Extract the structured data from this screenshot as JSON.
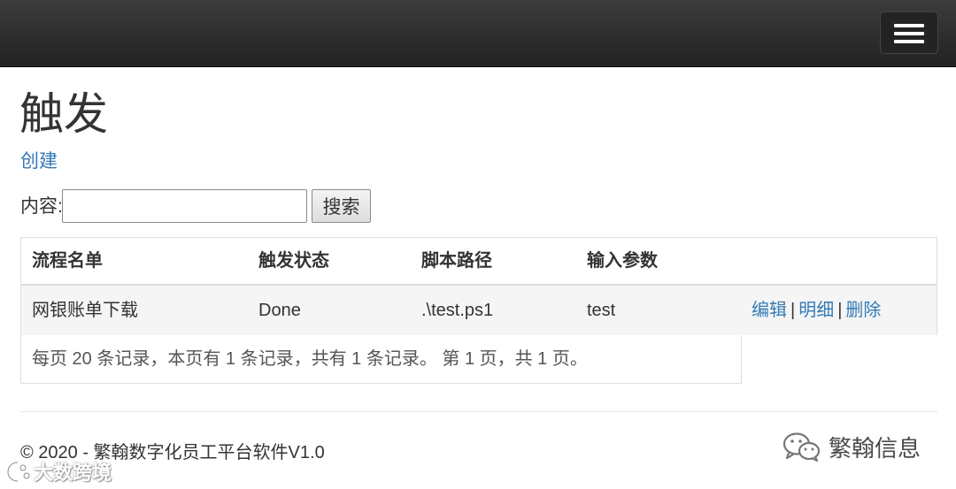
{
  "navbar": {
    "toggle_icon": "hamburger-menu-icon"
  },
  "page": {
    "title": "触发",
    "create_link": "创建"
  },
  "search": {
    "label": "内容:",
    "value": "",
    "placeholder": "",
    "button_label": "搜索"
  },
  "table": {
    "headers": [
      "流程名单",
      "触发状态",
      "脚本路径",
      "输入参数",
      ""
    ],
    "rows": [
      {
        "name": "网银账单下载",
        "status": "Done",
        "script_path": ".\\test.ps1",
        "params": "test",
        "actions": {
          "edit": "编辑",
          "separator1": "|",
          "details": "明细",
          "separator2": "|",
          "delete": "删除"
        }
      }
    ],
    "pager": "每页 20 条记录，本页有 1 条记录，共有 1 条记录。 第 1 页，共 1 页。"
  },
  "footer": {
    "copyright": "© 2020 - 繁翰数字化员工平台软件V1.0"
  },
  "watermarks": {
    "right_text": "繁翰信息",
    "right_icon": "wechat-icon",
    "left_text": "大数跨境",
    "left_icon": "logo-icon"
  }
}
